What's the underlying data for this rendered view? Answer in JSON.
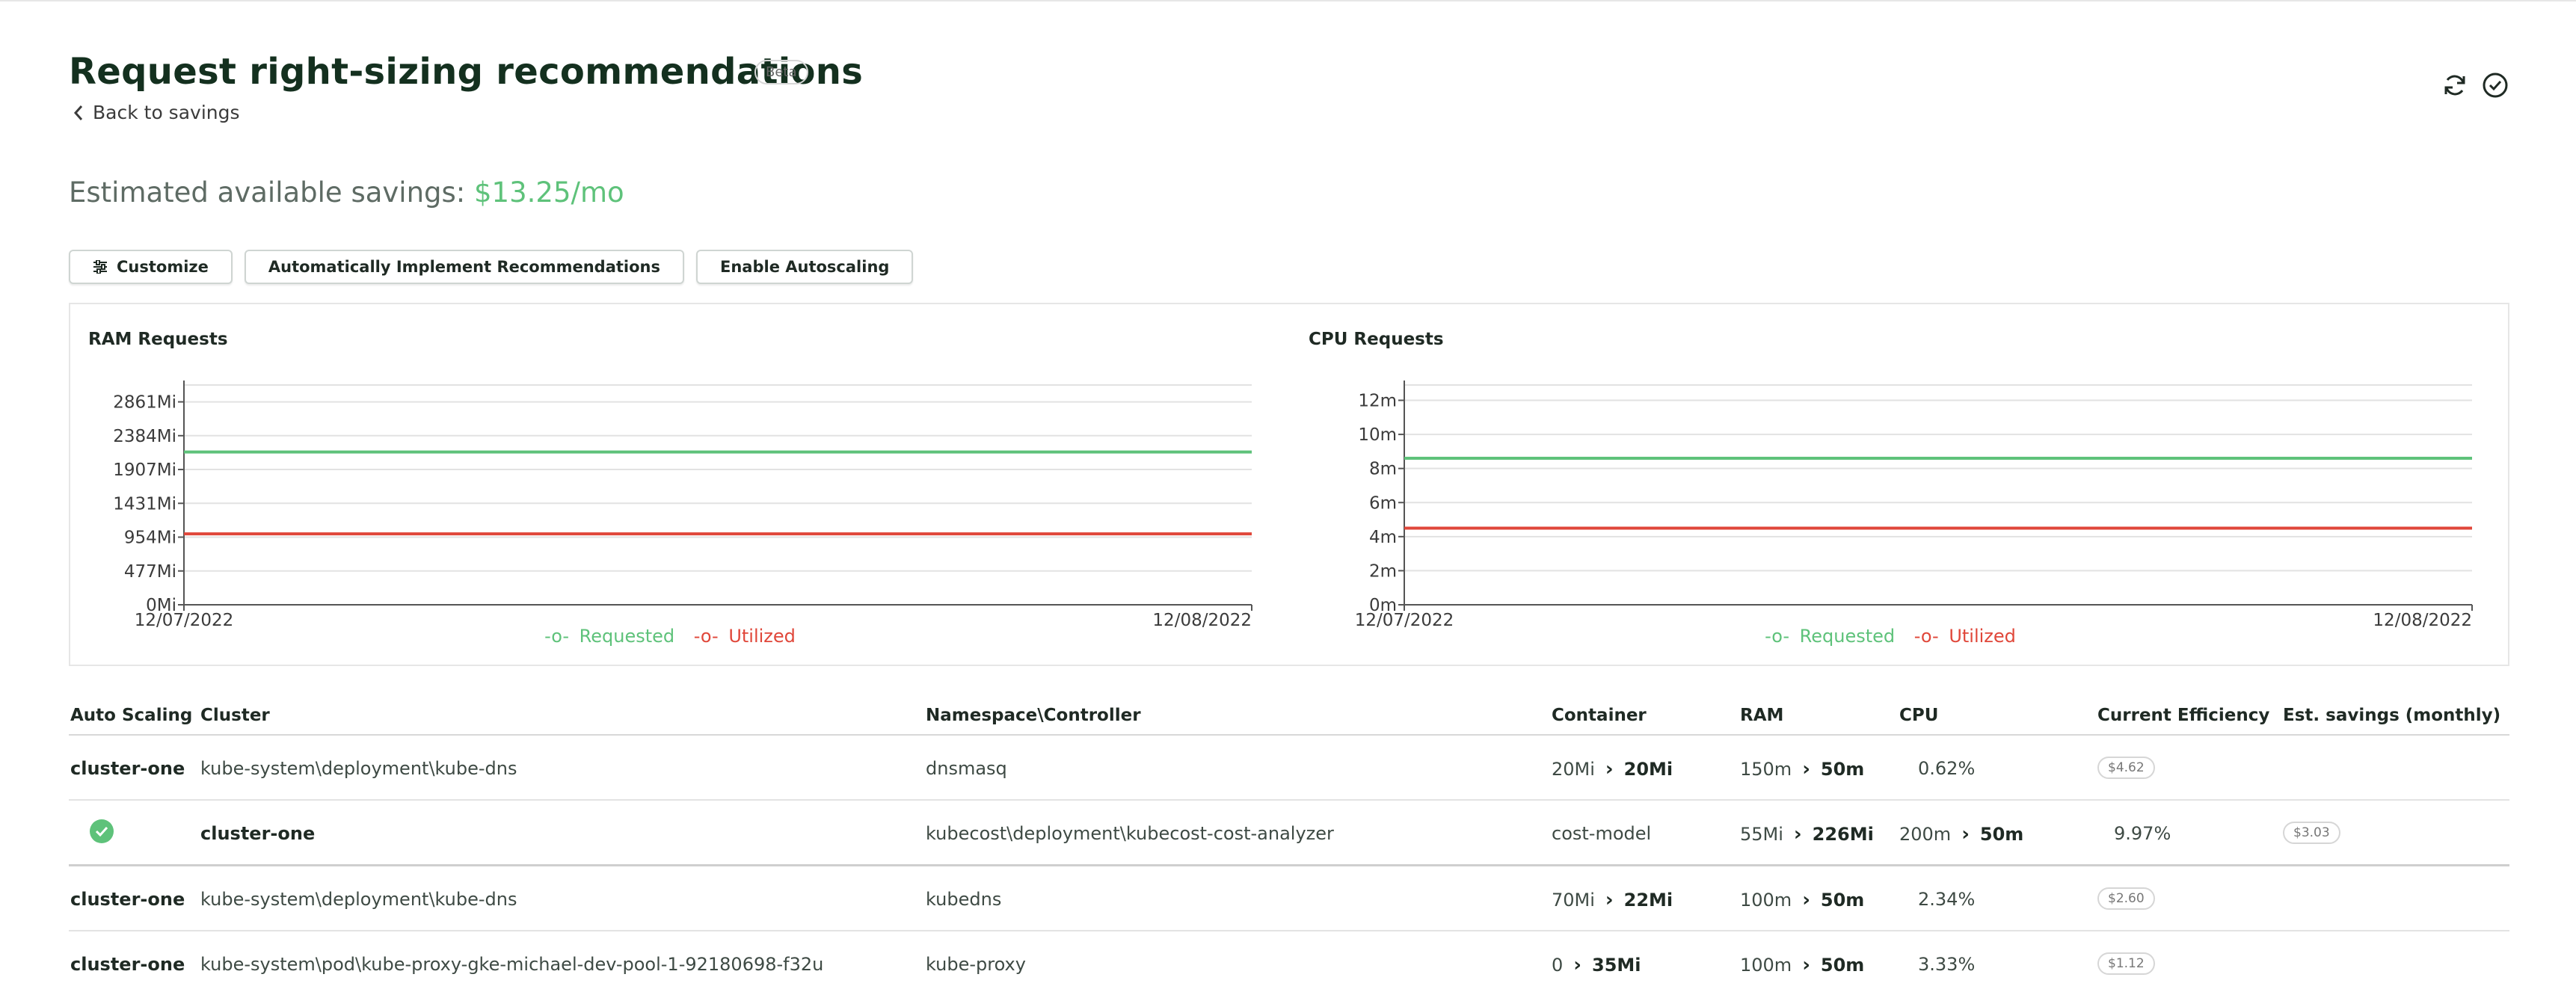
{
  "header": {
    "title": "Request right-sizing recommendations",
    "badge": "Beta",
    "back_label": "Back to savings",
    "icons": [
      "refresh-icon",
      "check-circle-icon"
    ]
  },
  "savings": {
    "label": "Estimated available savings: ",
    "amount": "$13.25/mo"
  },
  "actions": {
    "customize": "Customize",
    "auto_implement": "Automatically Implement Recommendations",
    "autoscaling": "Enable Autoscaling"
  },
  "colors": {
    "requested": "#5ec27a",
    "utilized": "#e0473a",
    "accent": "#5ec27a"
  },
  "chart_data": [
    {
      "type": "line",
      "title": "RAM Requests",
      "x": [
        "12/07/2022",
        "12/08/2022"
      ],
      "yticks": [
        "0Mi",
        "477Mi",
        "954Mi",
        "1431Mi",
        "1907Mi",
        "2384Mi",
        "2861Mi"
      ],
      "ylim": [
        0,
        3100
      ],
      "series": [
        {
          "name": "Requested",
          "values": [
            2155,
            2155
          ]
        },
        {
          "name": "Utilized",
          "values": [
            1000,
            1000
          ]
        }
      ],
      "legend_position": "bottom",
      "grid": true
    },
    {
      "type": "line",
      "title": "CPU Requests",
      "x": [
        "12/07/2022",
        "12/08/2022"
      ],
      "yticks": [
        "0m",
        "2m",
        "4m",
        "6m",
        "8m",
        "10m",
        "12m"
      ],
      "ylim": [
        0,
        12.9
      ],
      "series": [
        {
          "name": "Requested",
          "values": [
            8.6,
            8.6
          ]
        },
        {
          "name": "Utilized",
          "values": [
            4.5,
            4.5
          ]
        }
      ],
      "legend_position": "bottom",
      "grid": true
    }
  ],
  "table": {
    "columns": [
      "Auto Scaling",
      "Cluster",
      "Namespace\\Controller",
      "Container",
      "RAM",
      "CPU",
      "Current Efficiency",
      "Est. savings (monthly)"
    ],
    "rows": [
      {
        "autoscale": "cluster-one",
        "cluster": "kube-system\\deployment\\kube-dns",
        "namespace": "dnsmasq",
        "container_from": "20Mi",
        "container_to": "20Mi",
        "ram_from": "150m",
        "ram_to": "50m",
        "cpu": "0.62%",
        "efficiency": "$4.62"
      },
      {
        "autoscale_enabled": true,
        "cluster": "cluster-one",
        "namespace": "kubecost\\deployment\\kubecost-cost-analyzer",
        "container": "cost-model",
        "ram_from": "55Mi",
        "ram_to": "226Mi",
        "cpu_from": "200m",
        "cpu_to": "50m",
        "efficiency": "9.97%",
        "savings": "$3.03"
      },
      {
        "autoscale": "cluster-one",
        "cluster": "kube-system\\deployment\\kube-dns",
        "namespace": "kubedns",
        "container_from": "70Mi",
        "container_to": "22Mi",
        "ram_from": "100m",
        "ram_to": "50m",
        "cpu": "2.34%",
        "efficiency": "$2.60"
      },
      {
        "autoscale": "cluster-one",
        "cluster": "kube-system\\pod\\kube-proxy-gke-michael-dev-pool-1-92180698-f32u",
        "namespace": "kube-proxy",
        "container_from": "0",
        "container_to": "35Mi",
        "ram_from": "100m",
        "ram_to": "50m",
        "cpu": "3.33%",
        "efficiency": "$1.12"
      }
    ]
  }
}
